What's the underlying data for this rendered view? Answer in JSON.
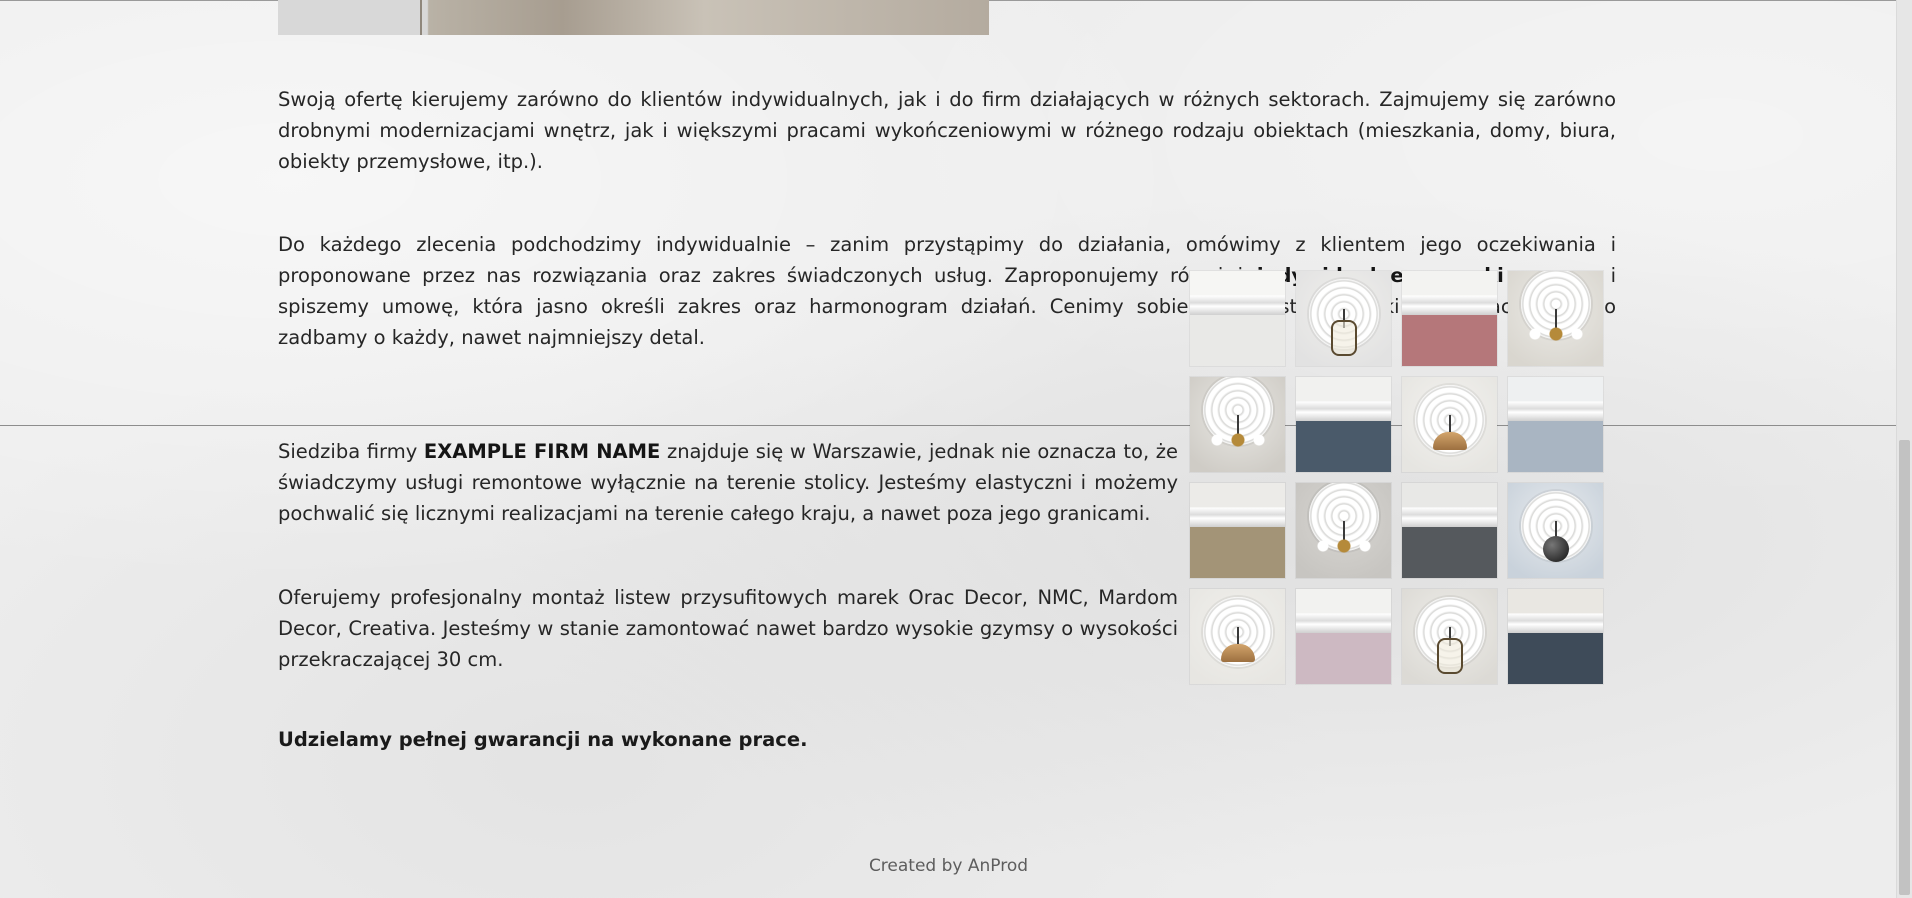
{
  "paragraphs": {
    "p1": "Swoją ofertę kierujemy zarówno do klientów indywidualnych, jak i do firm działających w różnych sektorach. Zajmujemy się zarówno drobnymi modernizacjami wnętrz, jak i większymi pracami wykończeniowymi w różnego rodzaju obiektach (mieszkania, domy, biura, obiekty przemysłowe, itp.).",
    "p2a": "Do każdego zlecenia podchodzimy indywidualnie – zanim przystąpimy do działania, omówimy z klientem jego oczekiwania i proponowane przez nas rozwiązania oraz zakres świadczonych usług. Zaproponujemy również ",
    "p2_bold": "indywidualne warunki cenowe",
    "p2b": " i spiszemy umowę, która jasno określi zakres oraz harmonogram działań. Cenimy sobie przejrzyste warunki współpracy, dlatego zadbamy o każdy, nawet najmniejszy detal.",
    "p3a": "Siedziba firmy ",
    "p3_bold": "EXAMPLE FIRM NAME",
    "p3b": " znajduje się w Warszawie, jednak nie oznacza to, że świadczymy usługi remontowe wyłącznie na terenie stolicy. Jesteśmy elastyczni i możemy pochwalić się licznymi realizacjami na terenie całego kraju, a nawet poza jego granicami.",
    "p4": "Oferujemy profesjonalny montaż listew przysufitowych marek Orac Decor, NMC, Mardom Decor, Creativa. Jesteśmy w stanie zamontować nawet bardzo wysokie gzymsy o wysokości przekraczającej 30 cm.",
    "guarantee": "Udzielamy pełnej gwarancji na wykonane prace."
  },
  "gallery": {
    "thumbnails": [
      {
        "kind": "cornice",
        "wall": "#e9e9e7",
        "ceiling": "#f6f6f4"
      },
      {
        "kind": "rosette-lantern",
        "wall": "#e2e2e2",
        "ceiling": "#f0efec"
      },
      {
        "kind": "cornice",
        "wall": "#b5777a",
        "ceiling": "#f3f3f1"
      },
      {
        "kind": "rosette-chandelier",
        "wall": "#d9d6cf",
        "ceiling": "#ecebe7"
      },
      {
        "kind": "rosette-chandelier",
        "wall": "#cfccc6",
        "ceiling": "#e9e8e4"
      },
      {
        "kind": "cornice",
        "wall": "#4a5a6a",
        "ceiling": "#f1f1ef"
      },
      {
        "kind": "rosette-pendant",
        "wall": "#e6e5e1",
        "ceiling": "#f3f2ef"
      },
      {
        "kind": "cornice",
        "wall": "#a9b5c2",
        "ceiling": "#eef0f1"
      },
      {
        "kind": "cornice",
        "wall": "#a39477",
        "ceiling": "#ecebe8"
      },
      {
        "kind": "rosette-chandelier",
        "wall": "#c7c5c1",
        "ceiling": "#d8d6d2"
      },
      {
        "kind": "cornice",
        "wall": "#55595d",
        "ceiling": "#e8e8e6"
      },
      {
        "kind": "rosette-globe",
        "wall": "#c9d2db",
        "ceiling": "#e8ebee"
      },
      {
        "kind": "rosette-pendant",
        "wall": "#e7e6e2",
        "ceiling": "#f1f0ec"
      },
      {
        "kind": "cornice",
        "wall": "#cdb9c2",
        "ceiling": "#f2f2f0"
      },
      {
        "kind": "rosette-lantern",
        "wall": "#dcdad5",
        "ceiling": "#eeede9"
      },
      {
        "kind": "cornice",
        "wall": "#3e4b59",
        "ceiling": "#e9e7e2"
      }
    ]
  },
  "footer": {
    "credit": "Created by AnProd"
  }
}
